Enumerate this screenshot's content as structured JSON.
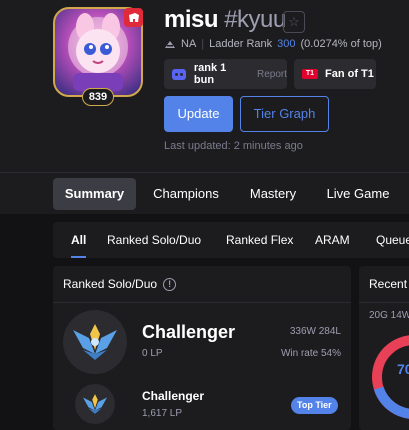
{
  "profile": {
    "level": "839",
    "name": "misu",
    "tag": "#kyuu",
    "region": "NA",
    "ladder_rank_label": "Ladder Rank",
    "ladder_rank": "300",
    "ladder_percent": "(0.0274% of top)",
    "chips": {
      "discord_label": "rank 1 bun",
      "report_label": "Report",
      "team_logo": "T1",
      "fan_label": "Fan of T1"
    },
    "update_label": "Update",
    "tier_graph_label": "Tier Graph",
    "last_updated": "Last updated: 2 minutes ago"
  },
  "main_tabs": [
    {
      "label": "Summary"
    },
    {
      "label": "Champions"
    },
    {
      "label": "Mastery"
    },
    {
      "label": "Live Game"
    }
  ],
  "queue_tabs": [
    {
      "label": "All"
    },
    {
      "label": "Ranked Solo/Duo"
    },
    {
      "label": "Ranked Flex"
    },
    {
      "label": "ARAM"
    },
    {
      "label": "Queue"
    }
  ],
  "ranked_card": {
    "title": "Ranked Solo/Duo",
    "current": {
      "tier": "Challenger",
      "lp": "0 LP",
      "wl": "336W 284L",
      "winrate": "Win rate 54%"
    },
    "peak": {
      "tier": "Challenger",
      "lp": "1,617 LP",
      "badge": "Top Tier"
    }
  },
  "recent_card": {
    "title": "Recent",
    "summary": "20G 14W",
    "winrate_display": "70",
    "win_fraction": 0.7
  },
  "colors": {
    "accent": "#5383e8",
    "loss": "#e84057",
    "riot_red": "#e02a3a",
    "gold": "#d2a94a"
  }
}
